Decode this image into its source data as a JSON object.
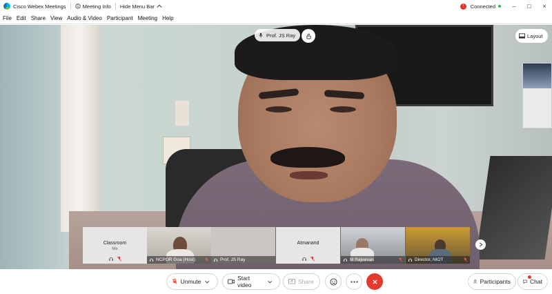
{
  "titlebar": {
    "app_title": "Cisco Webex Meetings",
    "meeting_info": "Meeting Info",
    "hide_menu_bar": "Hide Menu Bar",
    "connection_status": "Connected",
    "status_color": "#2fbf4f",
    "window_controls": [
      "–",
      "□",
      "×"
    ]
  },
  "menu": {
    "items": [
      "File",
      "Edit",
      "Share",
      "View",
      "Audio & Video",
      "Participant",
      "Meeting",
      "Help"
    ]
  },
  "stage": {
    "active_speaker": "Prof. JS Ray",
    "layout_label": "Layout"
  },
  "filmstrip": {
    "tiles": [
      {
        "name": "Classroom",
        "subtitle": "Me",
        "video": false
      },
      {
        "name": "NCPOR Goa (Host)",
        "video": true
      },
      {
        "name": "Prof. JS Ray",
        "video": false
      },
      {
        "name": "Atmanand",
        "video": false
      },
      {
        "name": "M Rajeevan",
        "video": true
      },
      {
        "name": "Director, NIOT",
        "video": true
      }
    ]
  },
  "toolbar": {
    "unmute": "Unmute",
    "start_video": "Start video",
    "share": "Share",
    "participants": "Participants",
    "chat": "Chat",
    "end_color": "#e33a2d"
  }
}
